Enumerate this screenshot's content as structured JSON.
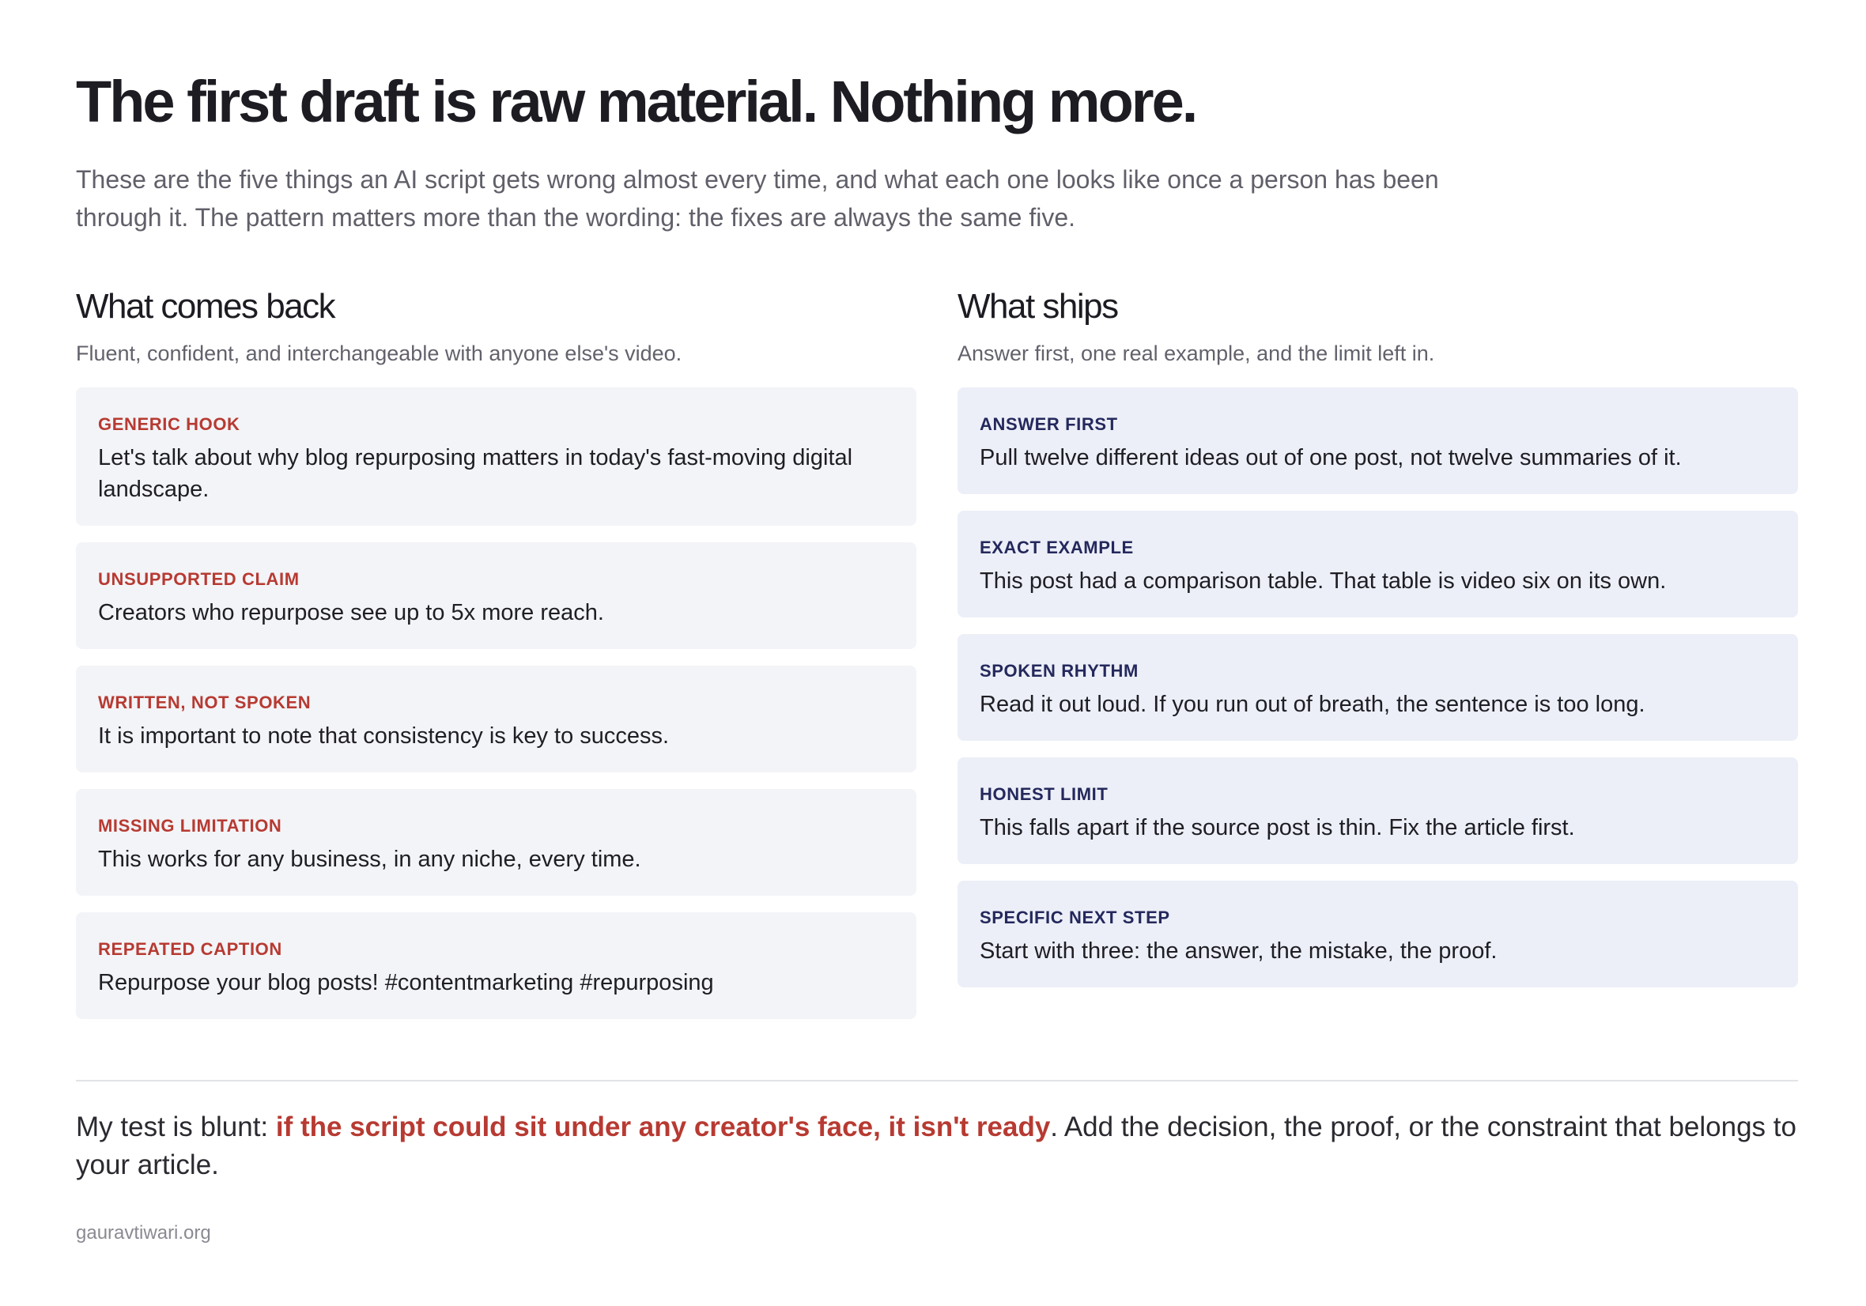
{
  "header": {
    "title": "The first draft is raw material. Nothing more.",
    "intro": "These are the five things an AI script gets wrong almost every time, and what each one looks like once a person has been through it. The pattern matters more than the wording: the fixes are always the same five."
  },
  "left_column": {
    "heading": "What comes back",
    "subtitle": "Fluent, confident, and interchangeable with anyone else's video.",
    "cards": [
      {
        "label": "GENERIC HOOK",
        "text": "Let's talk about why blog repurposing matters in today's fast-moving digital landscape."
      },
      {
        "label": "UNSUPPORTED CLAIM",
        "text": "Creators who repurpose see up to 5x more reach."
      },
      {
        "label": "WRITTEN, NOT SPOKEN",
        "text": "It is important to note that consistency is key to success."
      },
      {
        "label": "MISSING LIMITATION",
        "text": "This works for any business, in any niche, every time."
      },
      {
        "label": "REPEATED CAPTION",
        "text": "Repurpose your blog posts! #contentmarketing #repurposing"
      }
    ]
  },
  "right_column": {
    "heading": "What ships",
    "subtitle": "Answer first, one real example, and the limit left in.",
    "cards": [
      {
        "label": "ANSWER FIRST",
        "text": "Pull twelve different ideas out of one post, not twelve summaries of it."
      },
      {
        "label": "EXACT EXAMPLE",
        "text": "This post had a comparison table. That table is video six on its own."
      },
      {
        "label": "SPOKEN RHYTHM",
        "text": "Read it out loud. If you run out of breath, the sentence is too long."
      },
      {
        "label": "HONEST LIMIT",
        "text": "This falls apart if the source post is thin. Fix the article first."
      },
      {
        "label": "SPECIFIC NEXT STEP",
        "text": "Start with three: the answer, the mistake, the proof."
      }
    ]
  },
  "verdict": {
    "lead": "My test is blunt: ",
    "emphasis": "if the script could sit under any creator's face, it isn't ready",
    "tail": ". Add the decision, the proof, or the constraint that belongs to your article."
  },
  "footer": {
    "site": "gauravtiwari.org"
  },
  "colors": {
    "accent_red": "#b73a32",
    "accent_navy": "#24285c",
    "card_bad_bg": "#f3f4f7",
    "card_good_bg": "#eceff7"
  }
}
